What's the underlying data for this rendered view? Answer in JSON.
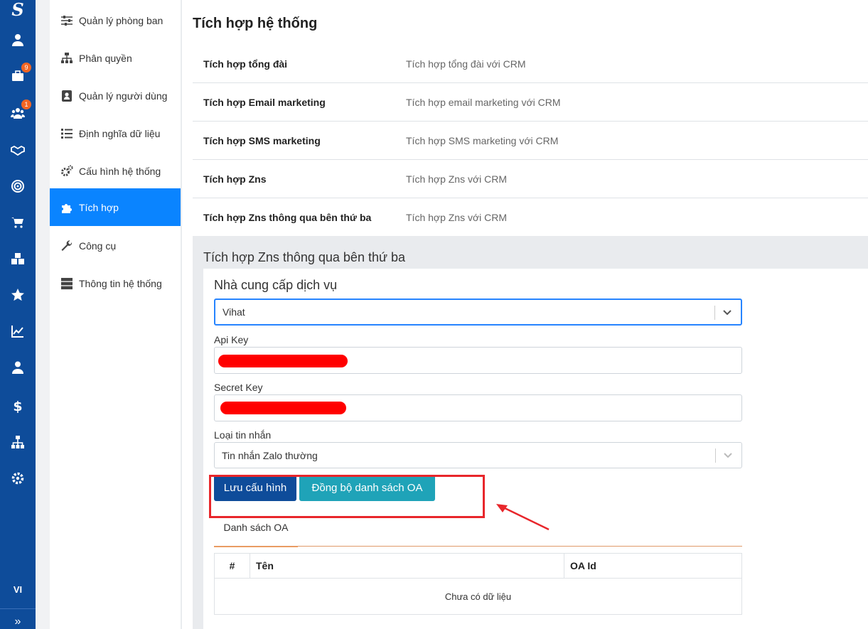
{
  "rail": {
    "logo": "S",
    "badges": {
      "briefcase": "9",
      "users": "1"
    },
    "icons": [
      "user-icon",
      "briefcase-icon",
      "users-icon",
      "handshake-icon",
      "target-icon",
      "cart-icon",
      "cubes-icon",
      "star-icon",
      "chart-line-icon",
      "user-tie-icon",
      "dollar-icon",
      "sitemap-icon",
      "gear-icon"
    ],
    "language": "VI",
    "expand": "»"
  },
  "menu": {
    "items": [
      {
        "label": "Quản lý phòng ban",
        "icon": "sliders-icon"
      },
      {
        "label": "Phân quyền",
        "icon": "sitemap-icon"
      },
      {
        "label": "Quản lý người dùng",
        "icon": "address-book-icon"
      },
      {
        "label": "Định nghĩa dữ liệu",
        "icon": "list-icon"
      },
      {
        "label": "Cấu hình hệ thống",
        "icon": "gears-icon"
      },
      {
        "label": "Tích hợp",
        "icon": "puzzle-icon",
        "active": true
      },
      {
        "label": "Công cụ",
        "icon": "wrench-icon"
      },
      {
        "label": "Thông tin hệ thống",
        "icon": "server-icon"
      }
    ]
  },
  "main": {
    "title": "Tích hợp hệ thống",
    "integrations": [
      {
        "name": "Tích hợp tổng đài",
        "desc": "Tích hợp tổng đài với CRM"
      },
      {
        "name": "Tích hợp Email marketing",
        "desc": "Tích hợp email marketing với CRM"
      },
      {
        "name": "Tích hợp SMS marketing",
        "desc": "Tích hợp SMS marketing với CRM"
      },
      {
        "name": "Tích hợp Zns",
        "desc": "Tích hợp Zns với CRM"
      },
      {
        "name": "Tích hợp Zns thông qua bên thứ ba",
        "desc": "Tích hợp Zns với CRM"
      }
    ]
  },
  "panel": {
    "title": "Tích hợp Zns thông qua bên thứ ba",
    "card_title": "Nhà cung cấp dịch vụ",
    "provider_value": "Vihat",
    "api_key_label": "Api Key",
    "secret_key_label": "Secret Key",
    "message_type_label": "Loại tin nhắn",
    "message_type_value": "Tin nhắn Zalo thường",
    "save_button": "Lưu cấu hình",
    "sync_button": "Đồng bộ danh sách OA",
    "tab_label": "Danh sách OA",
    "table": {
      "columns": [
        "#",
        "Tên",
        "OA Id"
      ],
      "empty": "Chưa có dữ liệu"
    }
  },
  "colors": {
    "rail": "#0e4c9a",
    "active_menu": "#0a84ff",
    "save_button": "#0e4c9a",
    "sync_button": "#1fa3b8",
    "annotation": "#e8262b",
    "redaction": "#ff0000"
  }
}
